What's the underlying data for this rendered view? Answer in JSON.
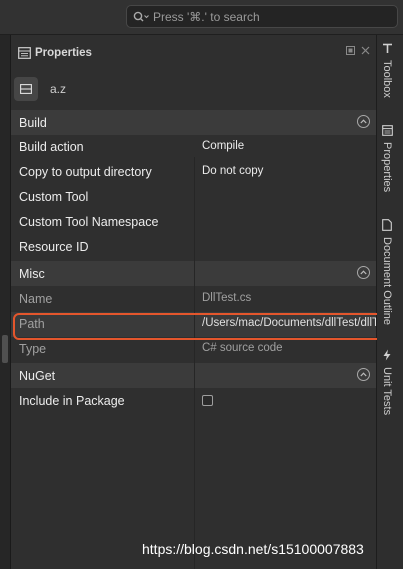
{
  "search": {
    "placeholder": "Press '⌘.' to search"
  },
  "panel": {
    "title": "Properties",
    "object_name": "a.z"
  },
  "sections": [
    {
      "label": "Build",
      "rows": [
        {
          "name": "Build action",
          "value": "Compile"
        },
        {
          "name": "Copy to output directory",
          "value": "Do not copy"
        },
        {
          "name": "Custom Tool",
          "value": ""
        },
        {
          "name": "Custom Tool Namespace",
          "value": ""
        },
        {
          "name": "Resource ID",
          "value": ""
        }
      ]
    },
    {
      "label": "Misc",
      "rows": [
        {
          "name": "Name",
          "value": "DllTest.cs"
        },
        {
          "name": "Path",
          "value": "/Users/mac/Documents/dllTest/dllTest/DllTest.cs"
        },
        {
          "name": "Type",
          "value": "C# source code"
        }
      ]
    },
    {
      "label": "NuGet",
      "rows": [
        {
          "name": "Include in Package",
          "value": "",
          "checked": false
        }
      ]
    }
  ],
  "right_tabs": [
    {
      "label": "Toolbox",
      "icon": "toolbox-icon"
    },
    {
      "label": "Properties",
      "icon": "properties-icon"
    },
    {
      "label": "Document Outline",
      "icon": "document-outline-icon"
    },
    {
      "label": "Unit Tests",
      "icon": "unit-tests-icon"
    }
  ],
  "watermark": "https://blog.csdn.net/s15100007883",
  "colors": {
    "highlight": "#e4562c",
    "panel_bg": "#2f2f2f",
    "section_bg": "#3b3b3b"
  }
}
